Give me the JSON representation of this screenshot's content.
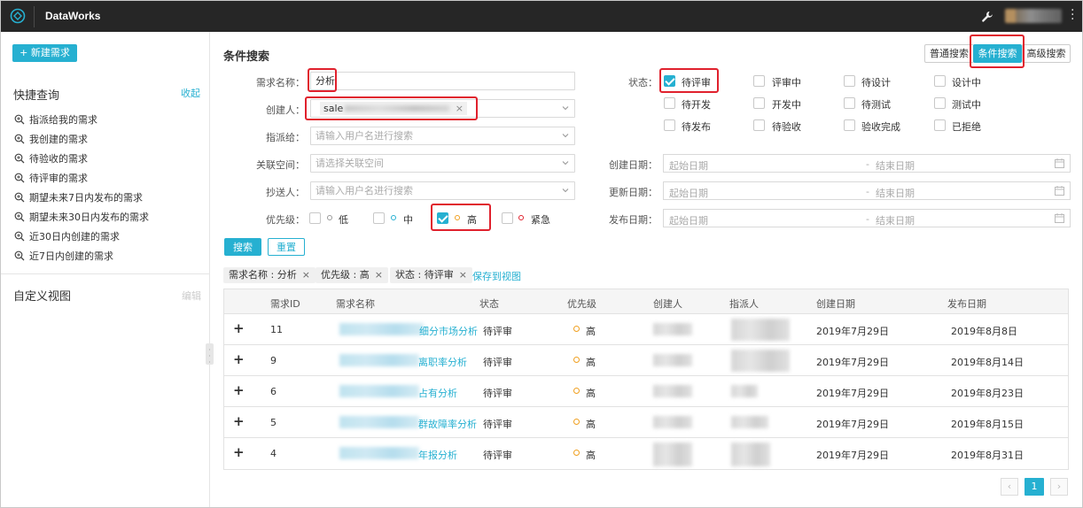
{
  "app": {
    "title": "DataWorks"
  },
  "sidebar": {
    "new_button": "+ 新建需求",
    "quick_query_title": "快捷查询",
    "collapse_link": "收起",
    "quick_items": [
      {
        "label": "指派给我的需求"
      },
      {
        "label": "我创建的需求"
      },
      {
        "label": "待验收的需求"
      },
      {
        "label": "待评审的需求"
      },
      {
        "label": "期望未来7日内发布的需求"
      },
      {
        "label": "期望未来30日内发布的需求"
      },
      {
        "label": "近30日内创建的需求"
      },
      {
        "label": "近7日内创建的需求"
      }
    ],
    "custom_view_title": "自定义视图",
    "edit_link": "编辑"
  },
  "search": {
    "section_title": "条件搜索",
    "modes": {
      "normal": "普通搜索",
      "condition": "条件搜索",
      "advanced": "高级搜索"
    },
    "fields": {
      "name_label": "需求名称：",
      "name_value": "分析",
      "creator_label": "创建人：",
      "creator_value": "sale",
      "assignee_label": "指派给：",
      "assignee_placeholder": "请输入用户名进行搜索",
      "space_label": "关联空间：",
      "space_placeholder": "请选择关联空间",
      "cc_label": "抄送人：",
      "cc_placeholder": "请输入用户名进行搜索",
      "priority_label": "优先级：",
      "status_label": "状态："
    },
    "priorities": [
      {
        "label": "低",
        "checked": false,
        "dot_color": "#999999"
      },
      {
        "label": "中",
        "checked": false,
        "dot_color": "#26b0d1"
      },
      {
        "label": "高",
        "checked": true,
        "dot_color": "#f0a020"
      },
      {
        "label": "紧急",
        "checked": false,
        "dot_color": "#e0212d"
      }
    ],
    "statuses": [
      {
        "label": "待评审",
        "checked": true
      },
      {
        "label": "评审中",
        "checked": false
      },
      {
        "label": "待设计",
        "checked": false
      },
      {
        "label": "设计中",
        "checked": false
      },
      {
        "label": "待开发",
        "checked": false
      },
      {
        "label": "开发中",
        "checked": false
      },
      {
        "label": "待测试",
        "checked": false
      },
      {
        "label": "测试中",
        "checked": false
      },
      {
        "label": "待发布",
        "checked": false
      },
      {
        "label": "待验收",
        "checked": false
      },
      {
        "label": "验收完成",
        "checked": false
      },
      {
        "label": "已拒绝",
        "checked": false
      }
    ],
    "dates": [
      {
        "label": "创建日期：",
        "start": "起始日期",
        "sep": "-",
        "end": "结束日期"
      },
      {
        "label": "更新日期：",
        "start": "起始日期",
        "sep": "-",
        "end": "结束日期"
      },
      {
        "label": "发布日期：",
        "start": "起始日期",
        "sep": "-",
        "end": "结束日期"
      }
    ],
    "search_button": "搜索",
    "reset_button": "重置"
  },
  "filters": {
    "tags": [
      {
        "label": "需求名称 : 分析",
        "remove": "×"
      },
      {
        "label": "优先级 : 高",
        "remove": "×"
      },
      {
        "label": "状态 : 待评审",
        "remove": "×"
      }
    ],
    "save_view": "保存到视图"
  },
  "table": {
    "columns": [
      "需求ID",
      "需求名称",
      "状态",
      "优先级",
      "创建人",
      "指派人",
      "创建日期",
      "发布日期"
    ],
    "rows": [
      {
        "expand": "+",
        "id": "11",
        "name_suffix": "细分市场分析",
        "status": "待评审",
        "priority": "高",
        "created": "2019年7月29日",
        "released": "2019年8月8日"
      },
      {
        "expand": "+",
        "id": "9",
        "name_suffix": "离职率分析",
        "status": "待评审",
        "priority": "高",
        "created": "2019年7月29日",
        "released": "2019年8月14日"
      },
      {
        "expand": "+",
        "id": "6",
        "name_suffix": "占有分析",
        "status": "待评审",
        "priority": "高",
        "created": "2019年7月29日",
        "released": "2019年8月23日"
      },
      {
        "expand": "+",
        "id": "5",
        "name_suffix": "群故障率分析",
        "status": "待评审",
        "priority": "高",
        "created": "2019年7月29日",
        "released": "2019年8月15日"
      },
      {
        "expand": "+",
        "id": "4",
        "name_suffix": "年报分析",
        "status": "待评审",
        "priority": "高",
        "created": "2019年7月29日",
        "released": "2019年8月31日"
      }
    ]
  },
  "pagination": {
    "prev": "‹",
    "current": "1",
    "next": "›"
  },
  "colors": {
    "accent": "#26b0d1",
    "highlight": "#e0212d",
    "topbar": "#262626",
    "priority_high": "#f0a020"
  }
}
